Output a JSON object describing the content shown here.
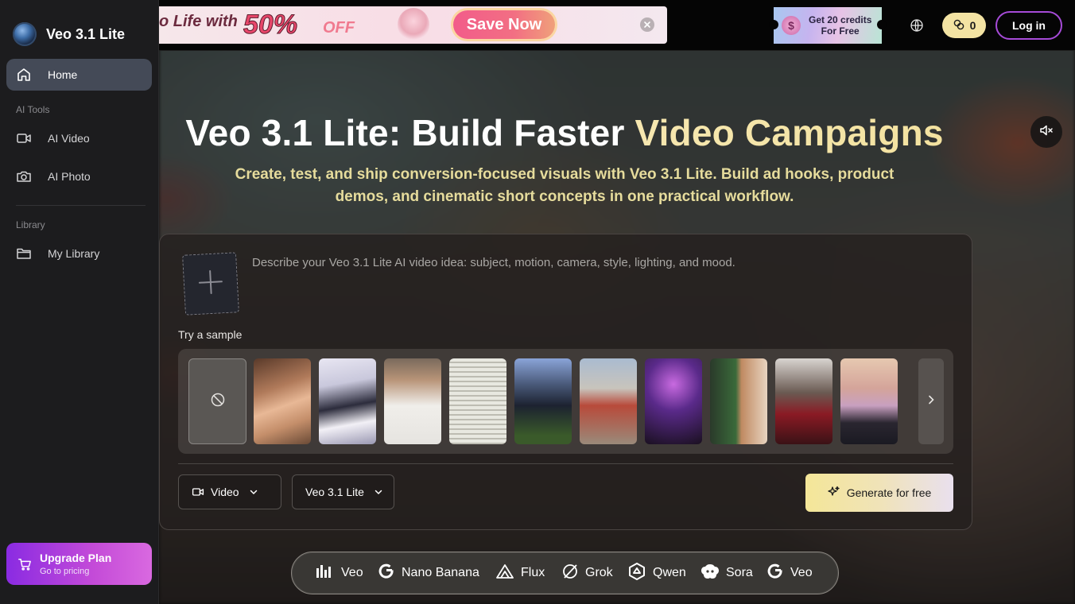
{
  "sidebar": {
    "brand": "Veo 3.1 Lite",
    "home": "Home",
    "section_tools": "AI Tools",
    "ai_video": "AI Video",
    "ai_photo": "AI Photo",
    "section_library": "Library",
    "my_library": "My Library",
    "upgrade_title": "Upgrade Plan",
    "upgrade_sub": "Go to pricing"
  },
  "topbar": {
    "promo_lead": "o Life with",
    "promo_pct": "50%",
    "promo_off": "OFF",
    "promo_button": "Save Now",
    "credits_line1": "Get 20 credits",
    "credits_line2": "For Free",
    "credit_count": "0",
    "login": "Log in"
  },
  "hero": {
    "title_white": "Veo 3.1 Lite: Build Faster ",
    "title_gold": "Video Campaigns",
    "subtitle": "Create, test, and ship conversion-focused visuals with Veo 3.1 Lite. Build ad hooks, product demos, and cinematic short concepts in one practical workflow."
  },
  "composer": {
    "prompt_placeholder": "Describe your Veo 3.1 Lite AI video idea: subject, motion, camera, style, lighting, and mood.",
    "try_sample": "Try a sample",
    "mode": "Video",
    "model": "Veo 3.1 Lite",
    "generate": "Generate for free",
    "samples": [
      "woman-portrait",
      "anime-maid",
      "man-white-sweater",
      "mug-on-shelf",
      "giant-robot",
      "red-hero-street",
      "party-dance",
      "couple-sports-field",
      "woman-red-dress",
      "cosplay-duo"
    ]
  },
  "models": [
    "Veo",
    "Nano Banana",
    "Flux",
    "Grok",
    "Qwen",
    "Sora",
    "Veo"
  ],
  "colors": {
    "accent_purple": "#a64bd8",
    "gold": "#f3e2a0",
    "sidebar_bg": "#1c1c1e"
  }
}
